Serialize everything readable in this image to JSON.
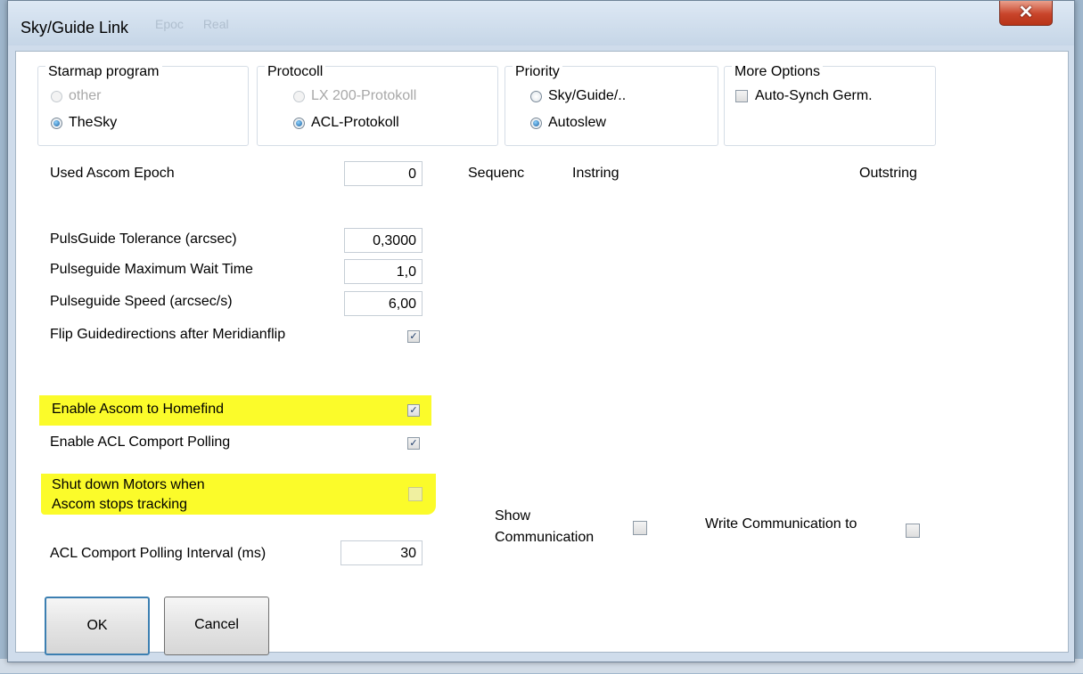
{
  "window": {
    "title": "Sky/Guide Link",
    "close_glyph": "✕"
  },
  "background_toolbar": {
    "item1": "Epoc",
    "item2": "Real"
  },
  "groups": {
    "starmap": {
      "title": "Starmap program",
      "options": [
        "other",
        "TheSky"
      ],
      "selected": "TheSky"
    },
    "protocol": {
      "title": "Protocoll",
      "options": [
        "LX 200-Protokoll",
        "ACL-Protokoll"
      ],
      "selected": "ACL-Protokoll"
    },
    "priority": {
      "title": "Priority",
      "options": [
        "Sky/Guide/..",
        "Autoslew"
      ],
      "selected": "Autoslew"
    },
    "more": {
      "title": "More Options",
      "auto_synch_label": "Auto-Synch Germ.",
      "auto_synch_checked": false
    }
  },
  "epoch": {
    "label": "Used Ascom Epoch",
    "value": "0"
  },
  "columns": {
    "sequenc": "Sequenc",
    "instring": "Instring",
    "outstring": "Outstring"
  },
  "pulse": {
    "tolerance_label": "PulsGuide Tolerance (arcsec)",
    "tolerance_value": "0,3000",
    "maxwait_label": "Pulseguide Maximum Wait Time",
    "maxwait_value": "1,0",
    "speed_label": "Pulseguide Speed (arcsec/s)",
    "speed_value": "6,00",
    "flip_label": "Flip Guidedirections after Meridianflip",
    "flip_checked": true
  },
  "options": {
    "homefind_label": "Enable Ascom to Homefind",
    "homefind_checked": true,
    "polling_label": "Enable ACL Comport Polling",
    "polling_checked": true,
    "shutdown_label_line1": "Shut down Motors when",
    "shutdown_label_line2": "Ascom stops tracking",
    "shutdown_checked": false,
    "interval_label": "ACL Comport Polling Interval (ms)",
    "interval_value": "30"
  },
  "communication": {
    "show_label_line1": "Show",
    "show_label_line2": "Communication",
    "show_checked": false,
    "write_label": "Write Communication to",
    "write_checked": false
  },
  "buttons": {
    "ok": "OK",
    "cancel": "Cancel"
  },
  "colors": {
    "highlight": "#fbfb2a",
    "close_red": "#c8442a",
    "radio_accent": "#1a5f9e"
  }
}
